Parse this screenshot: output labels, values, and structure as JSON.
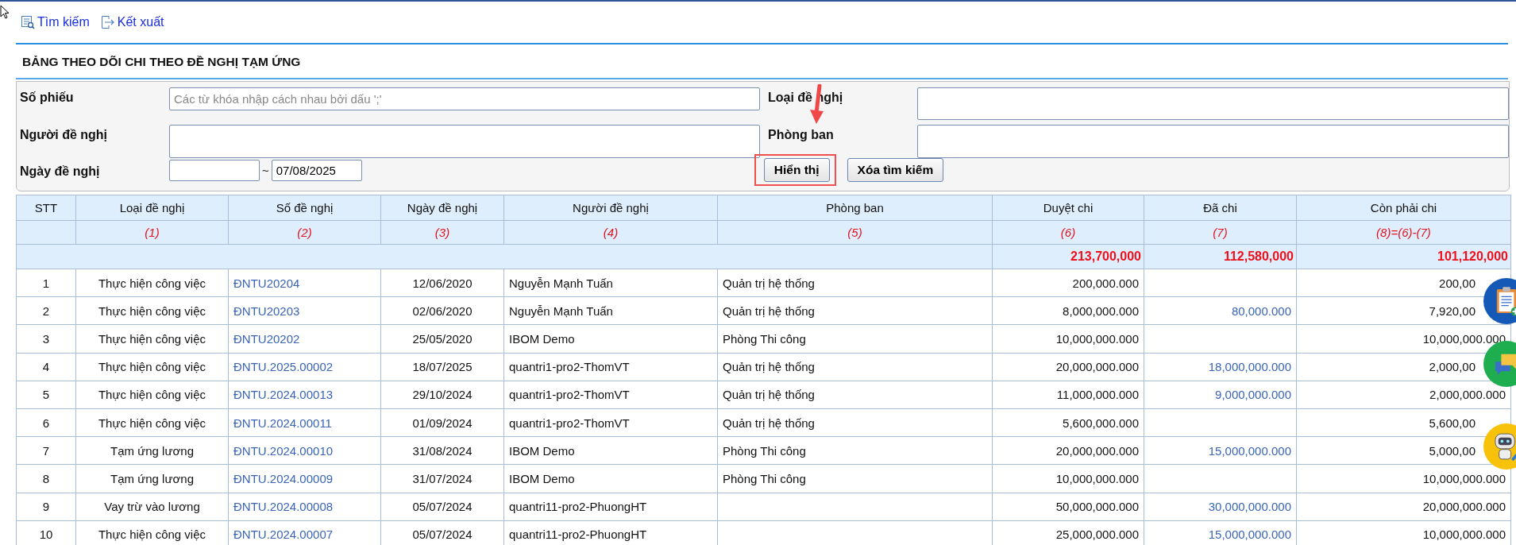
{
  "toolbar": [
    {
      "label": "Tìm kiếm"
    },
    {
      "label": "Kết xuất"
    }
  ],
  "title": "BẢNG THEO DÕI CHI THEO ĐỀ NGHỊ TẠM ỨNG",
  "filters": {
    "receipt_no": {
      "label": "Số phiếu",
      "placeholder": "Các từ khóa nhập cách nhau bởi dấu ';'"
    },
    "request_type": {
      "label": "Loại đề nghị"
    },
    "requester": {
      "label": "Người đề nghị"
    },
    "department": {
      "label": "Phòng ban"
    },
    "request_date": {
      "label": "Ngày đề nghị",
      "separator": "~",
      "to": "07/08/2025"
    },
    "buttons": [
      {
        "label": "Hiển thị",
        "highlighted": true
      },
      {
        "label": "Xóa tìm kiếm",
        "highlighted": false
      }
    ]
  },
  "table": {
    "columns": [
      {
        "label": "STT"
      },
      {
        "label": "Loại đề nghị",
        "index": "(1)"
      },
      {
        "label": "Số đề nghị",
        "index": "(2)"
      },
      {
        "label": "Ngày đề nghị",
        "index": "(3)"
      },
      {
        "label": "Người đề nghị",
        "index": "(4)"
      },
      {
        "label": "Phòng ban",
        "index": "(5)"
      },
      {
        "label": "Duyệt chi",
        "index": "(6)"
      },
      {
        "label": "Đã chi",
        "index": "(7)"
      },
      {
        "label": "Còn phải chi",
        "index": "(8)=(6)-(7)"
      }
    ],
    "totals": {
      "approved": "213,700,000",
      "paid": "112,580,000",
      "remaining": "101,120,000"
    },
    "rows": [
      {
        "stt": "1",
        "type": "Thực hiện công việc",
        "number": "ĐNTU20204",
        "date": "12/06/2020",
        "requester": "Nguyễn Mạnh Tuấn",
        "department": "Quản trị hệ thống",
        "approved": "200,000.000",
        "remaining": "200,00",
        "covered": true
      },
      {
        "stt": "2",
        "type": "Thực hiện công việc",
        "number": "ĐNTU20203",
        "date": "02/06/2020",
        "requester": "Nguyễn Mạnh Tuấn",
        "department": "Quản trị hệ thống",
        "approved": "8,000,000.000",
        "paid": "80,000.000",
        "remaining": "7,920,00",
        "covered": true
      },
      {
        "stt": "3",
        "type": "Thực hiện công việc",
        "number": "ĐNTU20202",
        "date": "25/05/2020",
        "requester": "IBOM Demo",
        "department": "Phòng Thi công",
        "approved": "10,000,000.000",
        "remaining": "10,000,000.000",
        "covered": false
      },
      {
        "stt": "4",
        "type": "Thực hiện công việc",
        "number": "ĐNTU.2025.00002",
        "date": "18/07/2025",
        "requester": "quantri1-pro2-ThomVT",
        "department": "Quản trị hệ thống",
        "approved": "20,000,000.000",
        "paid": "18,000,000.000",
        "remaining": "2,000,00",
        "covered": true
      },
      {
        "stt": "5",
        "type": "Thực hiện công việc",
        "number": "ĐNTU.2024.00013",
        "date": "29/10/2024",
        "requester": "quantri1-pro2-ThomVT",
        "department": "Quản trị hệ thống",
        "approved": "11,000,000.000",
        "paid": "9,000,000.000",
        "remaining": "2,000,000.000",
        "covered": false
      },
      {
        "stt": "6",
        "type": "Thực hiện công việc",
        "number": "ĐNTU.2024.00011",
        "date": "01/09/2024",
        "requester": "quantri1-pro2-ThomVT",
        "department": "Quản trị hệ thống",
        "approved": "5,600,000.000",
        "remaining": "5,600,00",
        "covered": true
      },
      {
        "stt": "7",
        "type": "Tạm ứng lương",
        "number": "ĐNTU.2024.00010",
        "date": "31/08/2024",
        "requester": "IBOM Demo",
        "department": "Phòng Thi công",
        "approved": "20,000,000.000",
        "paid": "15,000,000.000",
        "remaining": "5,000,00",
        "covered": true
      },
      {
        "stt": "8",
        "type": "Tạm ứng lương",
        "number": "ĐNTU.2024.00009",
        "date": "31/07/2024",
        "requester": "IBOM Demo",
        "department": "Phòng Thi công",
        "approved": "10,000,000.000",
        "remaining": "10,000,000.000",
        "covered": false
      },
      {
        "stt": "9",
        "type": "Vay trừ vào lương",
        "number": "ĐNTU.2024.00008",
        "date": "05/07/2024",
        "requester": "quantri11-pro2-PhuongHT",
        "approved": "50,000,000.000",
        "paid": "30,000,000.000",
        "remaining": "20,000,000.000",
        "covered": false
      },
      {
        "stt": "10",
        "type": "Thực hiện công việc",
        "number": "ĐNTU.2024.00007",
        "date": "05/07/2024",
        "requester": "quantri11-pro2-PhuongHT",
        "approved": "25,000,000.000",
        "paid": "15,000,000.000",
        "remaining": "10,000,000.000",
        "covered": false
      }
    ]
  }
}
